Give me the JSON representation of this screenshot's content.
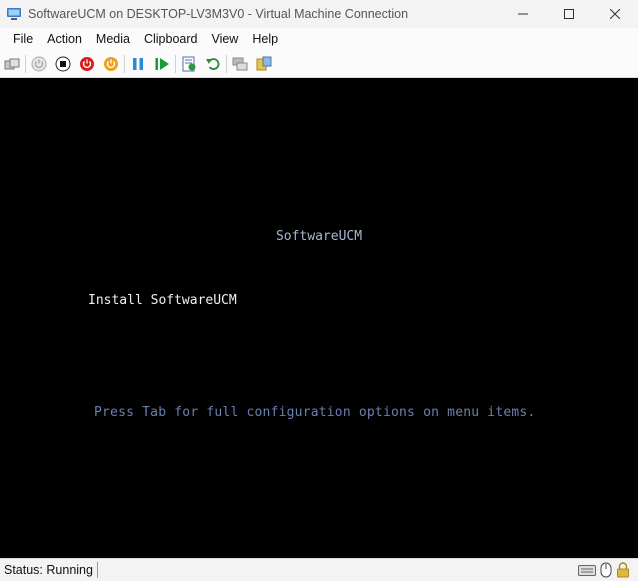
{
  "window": {
    "title": "SoftwareUCM on DESKTOP-LV3M3V0 - Virtual Machine Connection",
    "icon": "vm-connection-icon",
    "controls": [
      "minimize-icon",
      "maximize-icon",
      "close-icon"
    ]
  },
  "menu": {
    "items": [
      "File",
      "Action",
      "Media",
      "Clipboard",
      "View",
      "Help"
    ]
  },
  "toolbar": {
    "buttons": [
      "ctrl-alt-del-icon",
      "start-icon",
      "turn-off-icon",
      "shut-down-icon",
      "save-icon",
      "pause-icon",
      "reset-icon",
      "checkpoint-icon",
      "revert-icon",
      "enhanced-session-icon",
      "share-icon"
    ]
  },
  "screen": {
    "boot_title": "SoftwareUCM",
    "menu_entry": "Install SoftwareUCM",
    "hint": "Press Tab for full configuration options on menu items."
  },
  "status": {
    "text": "Status: Running",
    "icons": [
      "keyboard-icon",
      "mouse-icon",
      "lock-icon"
    ]
  },
  "colors": {
    "screen_bg": "#000000",
    "boot_title": "#a9b6d4",
    "menu_entry": "#f0f0f0",
    "hint": "#6a80b0"
  }
}
